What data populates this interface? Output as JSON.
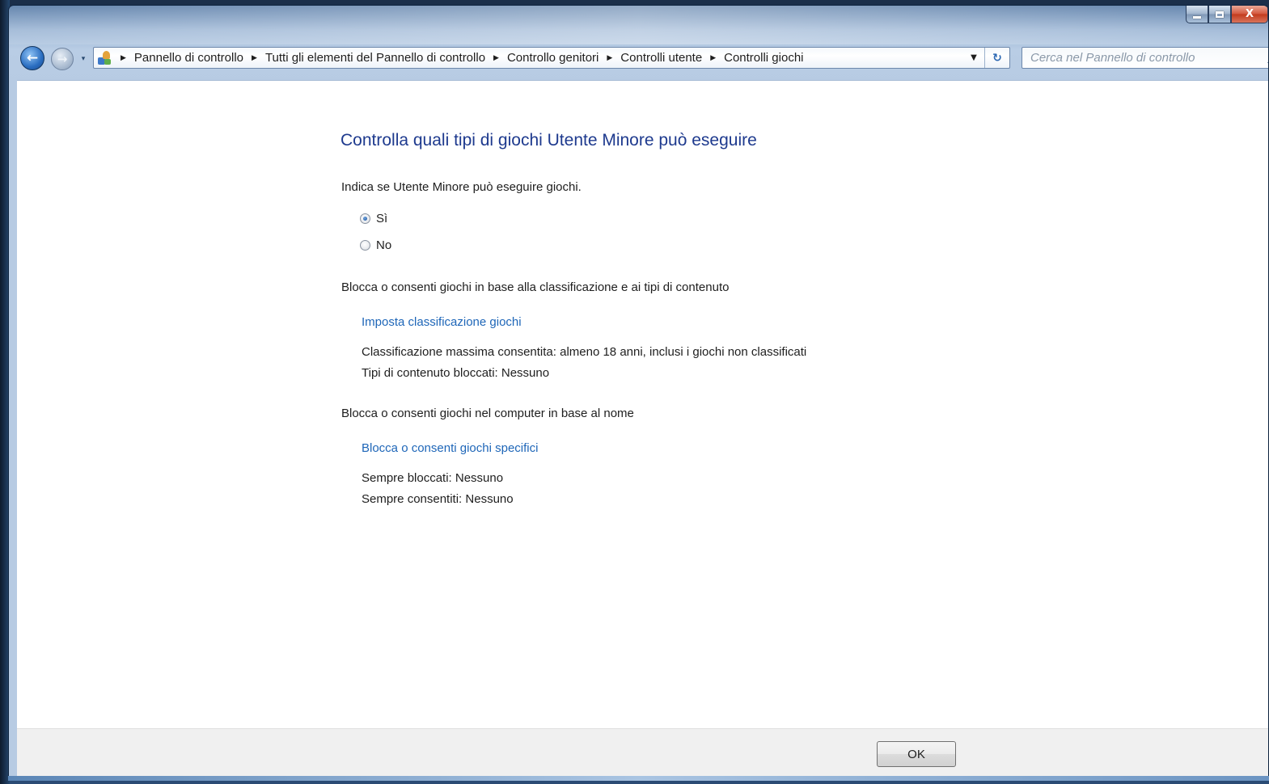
{
  "window": {
    "caption_buttons": {
      "minimize_icon": "minimize-icon",
      "maximize_icon": "maximize-icon",
      "close_label": "X"
    }
  },
  "navigation": {
    "back_icon": "back-arrow-icon",
    "forward_icon": "forward-arrow-icon",
    "back_glyph": "←",
    "forward_glyph": "→",
    "recent_glyph": "▾",
    "breadcrumbs": [
      "Pannello di controllo",
      "Tutti gli elementi del Pannello di controllo",
      "Controllo genitori",
      "Controlli utente",
      "Controlli giochi"
    ],
    "dropdown_glyph": "▼",
    "refresh_glyph": "↻",
    "search_placeholder": "Cerca nel Pannello di controllo"
  },
  "main": {
    "title": "Controlla quali tipi di giochi Utente Minore può eseguire",
    "question": "Indica se Utente Minore può eseguire giochi.",
    "radio_options": [
      {
        "label": "Sì",
        "checked": true
      },
      {
        "label": "No",
        "checked": false
      }
    ],
    "rating_section": {
      "heading": "Blocca o consenti giochi in base alla classificazione e ai tipi di contenuto",
      "link": "Imposta classificazione giochi",
      "max_rating": "Classificazione massima consentita:  almeno 18 anni, inclusi i giochi non classificati",
      "blocked_content": "Tipi di contenuto bloccati:  Nessuno"
    },
    "name_section": {
      "heading": "Blocca o consenti giochi nel computer in base al nome",
      "link": "Blocca o consenti giochi specifici",
      "always_blocked": "Sempre bloccati:  Nessuno",
      "always_allowed": "Sempre consentiti:  Nessuno"
    }
  },
  "footer": {
    "ok_label": "OK"
  },
  "colors": {
    "title_blue": "#1e3a8e",
    "link_blue": "#1e66b8",
    "close_red": "#c23a1c"
  }
}
